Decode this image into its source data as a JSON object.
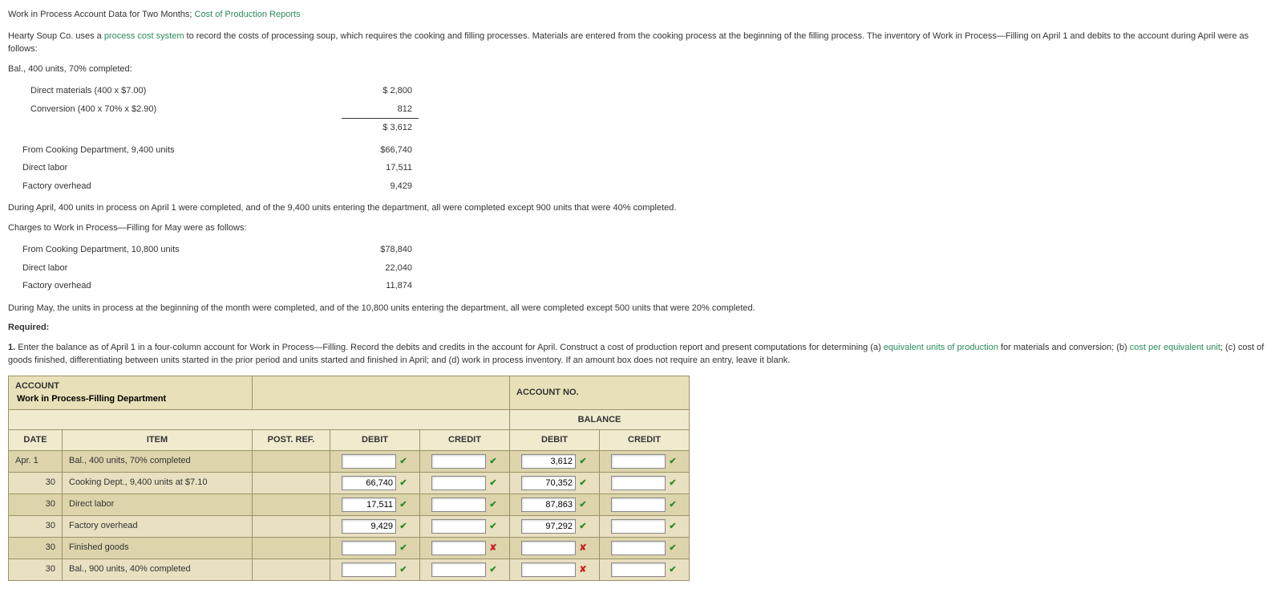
{
  "title_part1": "Work in Process Account Data for Two Months; ",
  "title_part2": "Cost of Production Reports",
  "intro_p1": "Hearty Soup Co. uses a ",
  "intro_link": "process cost system",
  "intro_p2": " to record the costs of processing soup, which requires the cooking and filling processes. Materials are entered from the cooking process at the beginning of the filling process. The inventory of Work in Process—Filling on April 1 and debits to the account during April were as follows:",
  "bal_line": "Bal., 400 units, 70% completed:",
  "cost1": {
    "r1_label": "Direct materials (400 x $7.00)",
    "r1_amt": "$ 2,800",
    "r2_label": "Conversion (400 x 70% x $2.90)",
    "r2_amt": "812",
    "r3_amt": "$ 3,612"
  },
  "cost2": {
    "r1_label": "From Cooking Department, 9,400 units",
    "r1_amt": "$66,740",
    "r2_label": "Direct labor",
    "r2_amt": "17,511",
    "r3_label": "Factory overhead",
    "r3_amt": "9,429"
  },
  "mid_p1": "During April, 400 units in process on April 1 were completed, and of the 9,400 units entering the department, all were completed except 900 units that were 40% completed.",
  "mid_p2": "Charges to Work in Process—Filling for May were as follows:",
  "cost3": {
    "r1_label": "From Cooking Department, 10,800 units",
    "r1_amt": "$78,840",
    "r2_label": "Direct labor",
    "r2_amt": "22,040",
    "r3_label": "Factory overhead",
    "r3_amt": "11,874"
  },
  "mid_p3": "During May, the units in process at the beginning of the month were completed, and of the 10,800 units entering the department, all were completed except 500 units that were 20% completed.",
  "required_label": "Required:",
  "req_1a": "1.",
  "req_1b": " Enter the balance as of April 1 in a four-column account for Work in Process—Filling. Record the debits and credits in the account for April. Construct a cost of production report and present computations for determining (a) ",
  "req_link1": "equivalent units of production",
  "req_1c": " for materials and conversion; (b) ",
  "req_link2": "cost per equivalent unit",
  "req_1d": "; (c) cost of goods finished, differentiating between units started in the prior period and units started and finished in April; and (d) work in process inventory. If an amount box does not require an entry, leave it blank.",
  "account": {
    "account_label": "ACCOUNT",
    "account_name": "Work in Process-Filling Department",
    "account_no_label": "ACCOUNT NO.",
    "balance_label": "BALANCE",
    "col_date": "DATE",
    "col_item": "ITEM",
    "col_postref": "POST. REF.",
    "col_debit": "DEBIT",
    "col_credit": "CREDIT",
    "rows": [
      {
        "date": "Apr. 1",
        "item": "Bal., 400 units, 70% completed",
        "debit": "",
        "dm": "✔",
        "credit": "",
        "cm": "✔",
        "bdebit": "3,612",
        "bdm": "✔",
        "bcredit": "",
        "bcm": "✔"
      },
      {
        "date": "30",
        "item": "Cooking Dept., 9,400 units at $7.10",
        "debit": "66,740",
        "dm": "✔",
        "credit": "",
        "cm": "✔",
        "bdebit": "70,352",
        "bdm": "✔",
        "bcredit": "",
        "bcm": "✔"
      },
      {
        "date": "30",
        "item": "Direct labor",
        "debit": "17,511",
        "dm": "✔",
        "credit": "",
        "cm": "✔",
        "bdebit": "87,863",
        "bdm": "✔",
        "bcredit": "",
        "bcm": "✔"
      },
      {
        "date": "30",
        "item": "Factory overhead",
        "debit": "9,429",
        "dm": "✔",
        "credit": "",
        "cm": "✔",
        "bdebit": "97,292",
        "bdm": "✔",
        "bcredit": "",
        "bcm": "✔"
      },
      {
        "date": "30",
        "item": "Finished goods",
        "debit": "",
        "dm": "✔",
        "credit": "",
        "cm": "✘",
        "bdebit": "",
        "bdm": "✘",
        "bcredit": "",
        "bcm": "✔"
      },
      {
        "date": "30",
        "item": "Bal., 900 units, 40% completed",
        "debit": "",
        "dm": "✔",
        "credit": "",
        "cm": "✔",
        "bdebit": "",
        "bdm": "✘",
        "bcredit": "",
        "bcm": "✔"
      }
    ]
  }
}
